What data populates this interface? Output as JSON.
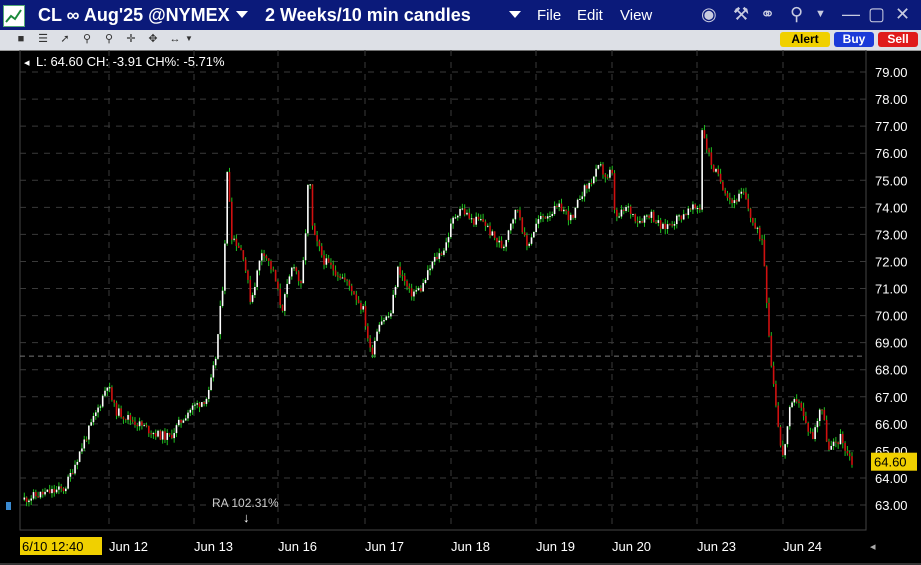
{
  "window": {
    "symbol": "CL ∞ Aug'25 @NYMEX",
    "period": "2 Weeks/10 min candles",
    "menu": [
      "File",
      "Edit",
      "View"
    ]
  },
  "buttons": {
    "alert": "Alert",
    "buy": "Buy",
    "sell": "Sell"
  },
  "info_line": "L: 64.60 CH: -3.91 CH%: -5.71%",
  "current_price_label": "64.60",
  "annotation": "RA 102.31%",
  "colors": {
    "title_bg": "#0b1a7a",
    "up_candle": "#ffffff",
    "down_candle": "#d01010",
    "wick": "#20c020",
    "price_tag": "#f0d000",
    "grid": "#555555"
  },
  "chart_data": {
    "type": "candlestick",
    "y_range": [
      62.6,
      79.5
    ],
    "y_ticks": [
      "63.00",
      "64.00",
      "65.00",
      "66.00",
      "67.00",
      "68.00",
      "69.00",
      "70.00",
      "71.00",
      "72.00",
      "73.00",
      "74.00",
      "75.00",
      "76.00",
      "77.00",
      "78.00",
      "79.00"
    ],
    "x_tick_labels": [
      "6/10 12:40",
      "Jun 12",
      "Jun 13",
      "Jun 16",
      "Jun 17",
      "Jun 18",
      "Jun 19",
      "Jun 20",
      "Jun 23",
      "Jun 24"
    ],
    "reference_line": 68.5,
    "last_price": 64.6,
    "price_path": [
      [
        0,
        63.2
      ],
      [
        5,
        63.4
      ],
      [
        11,
        63.6
      ],
      [
        15,
        65
      ],
      [
        20,
        66.7
      ],
      [
        22,
        67.5
      ],
      [
        24,
        66.5
      ],
      [
        30,
        66
      ],
      [
        35,
        65.6
      ],
      [
        38,
        65.5
      ],
      [
        43,
        66.5
      ],
      [
        48,
        67.0
      ],
      [
        50,
        68.5
      ],
      [
        52,
        71.5
      ],
      [
        53,
        75.6
      ],
      [
        54,
        73
      ],
      [
        57,
        72.3
      ],
      [
        59,
        70.5
      ],
      [
        62,
        72.5
      ],
      [
        65,
        71.5
      ],
      [
        67,
        70.2
      ],
      [
        70,
        72.0
      ],
      [
        72,
        71.0
      ],
      [
        73,
        72.8
      ],
      [
        74,
        75.5
      ],
      [
        75,
        73.0
      ],
      [
        78,
        72
      ],
      [
        82,
        71.5
      ],
      [
        85,
        71.0
      ],
      [
        88,
        70.2
      ],
      [
        90,
        68.5
      ],
      [
        92,
        69.8
      ],
      [
        95,
        70.0
      ],
      [
        97,
        71.8
      ],
      [
        100,
        70.8
      ],
      [
        103,
        71.0
      ],
      [
        106,
        72.0
      ],
      [
        109,
        72.5
      ],
      [
        111,
        73.5
      ],
      [
        113,
        74.0
      ],
      [
        116,
        73.5
      ],
      [
        119,
        73.5
      ],
      [
        121,
        73.0
      ],
      [
        124,
        72.5
      ],
      [
        126,
        73.5
      ],
      [
        128,
        74.0
      ],
      [
        130,
        72.5
      ],
      [
        133,
        73.5
      ],
      [
        136,
        73.8
      ],
      [
        139,
        74.0
      ],
      [
        142,
        73.5
      ],
      [
        144,
        74.5
      ],
      [
        146,
        74.8
      ],
      [
        149,
        75.5
      ],
      [
        151,
        75.0
      ],
      [
        152,
        75.5
      ],
      [
        153,
        73.5
      ],
      [
        156,
        74.0
      ],
      [
        159,
        73.5
      ],
      [
        162,
        73.8
      ],
      [
        165,
        73.2
      ],
      [
        168,
        73.5
      ],
      [
        171,
        73.8
      ],
      [
        174,
        74.0
      ],
      [
        175,
        74.0
      ],
      [
        175.5,
        78.0
      ],
      [
        176,
        76.5
      ],
      [
        178,
        75.5
      ],
      [
        180,
        75.0
      ],
      [
        183,
        74.2
      ],
      [
        186,
        74.5
      ],
      [
        189,
        73.2
      ],
      [
        191,
        72.8
      ],
      [
        193,
        68.5
      ],
      [
        195,
        66.0
      ],
      [
        196,
        64.6
      ],
      [
        198,
        66.5
      ],
      [
        200,
        67.0
      ],
      [
        202,
        66.0
      ],
      [
        204,
        65.5
      ],
      [
        206,
        66.8
      ],
      [
        208,
        65.0
      ],
      [
        211,
        65.5
      ],
      [
        214,
        64.6
      ]
    ]
  }
}
